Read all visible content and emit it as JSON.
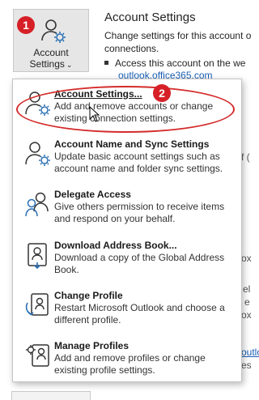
{
  "account_button": {
    "label_line1": "Account",
    "label_line2": "Settings",
    "chevron": "⌄",
    "icon": "person-gear-icon"
  },
  "badges": {
    "one": "1",
    "two": "2"
  },
  "background": {
    "title": "Account Settings",
    "description": "Change settings for this account or set up more connections.",
    "description_visible": "Change settings for this account o\nconnections.",
    "bullet": "Access this account on the we",
    "link": "outlook.office365.com",
    "fragments": [
      "f (",
      "ox",
      "el",
      "e",
      "ox",
      "outlo",
      "es"
    ]
  },
  "menu": {
    "items": [
      {
        "title": "Account Settings...",
        "desc": "Add and remove accounts or change existing connection settings.",
        "icon": "person-gear-icon"
      },
      {
        "title": "Account Name and Sync Settings",
        "desc": "Update basic account settings such as account name and folder sync settings.",
        "icon": "person-gear-icon"
      },
      {
        "title": "Delegate Access",
        "desc": "Give others permission to receive items and respond on your behalf.",
        "icon": "people-icon"
      },
      {
        "title": "Download Address Book...",
        "desc": "Download a copy of the Global Address Book.",
        "icon": "address-book-icon"
      },
      {
        "title": "Change Profile",
        "desc": "Restart Microsoft Outlook and choose a different profile.",
        "icon": "profile-switch-icon"
      },
      {
        "title": "Manage Profiles",
        "desc": "Add and remove profiles or change existing profile settings.",
        "icon": "gear-person-icon"
      }
    ]
  },
  "colors": {
    "badge": "#d61f26",
    "highlight": "#d42b2b",
    "icon_blue": "#2a6fb3"
  }
}
